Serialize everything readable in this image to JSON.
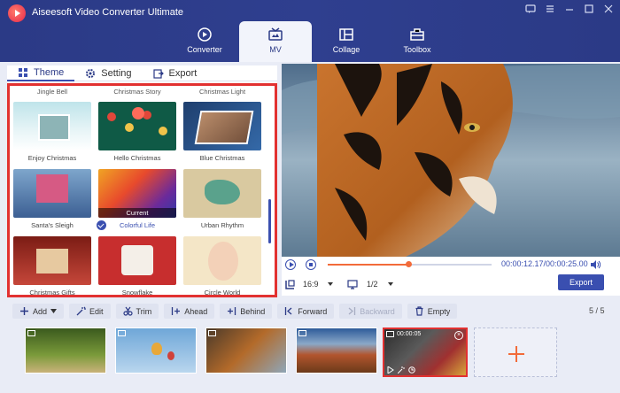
{
  "app": {
    "title": "Aiseesoft Video Converter Ultimate",
    "accent": "#3a4fb0",
    "highlight": "#e23131"
  },
  "nav": {
    "tabs": [
      {
        "label": "Converter",
        "icon": "converter-icon"
      },
      {
        "label": "MV",
        "icon": "mv-icon",
        "active": true
      },
      {
        "label": "Collage",
        "icon": "collage-icon"
      },
      {
        "label": "Toolbox",
        "icon": "toolbox-icon"
      }
    ]
  },
  "subtabs": {
    "theme": "Theme",
    "setting": "Setting",
    "export": "Export"
  },
  "themes": {
    "top_labels": [
      "Jingle Bell",
      "Christmas Story",
      "Christmas Light"
    ],
    "items": [
      "Enjoy Christmas",
      "Hello Christmas",
      "Blue Christmas",
      "Santa's Sleigh",
      "Colorful Life",
      "Urban Rhythm",
      "Christmas Gifts",
      "Snowflake",
      "Circle World"
    ],
    "current_badge": "Current",
    "selected": "Colorful Life"
  },
  "player": {
    "progress": 0.49,
    "timecode": "00:00:12.17/00:00:25.00",
    "ratio": "16:9",
    "screen": "1/2",
    "export_label": "Export"
  },
  "toolbar": {
    "add": "Add",
    "edit": "Edit",
    "trim": "Trim",
    "ahead": "Ahead",
    "behind": "Behind",
    "forward": "Forward",
    "backward": "Backward",
    "empty": "Empty",
    "count": "5 / 5"
  },
  "timeline": {
    "selected_clip_time": "00:00:05"
  }
}
